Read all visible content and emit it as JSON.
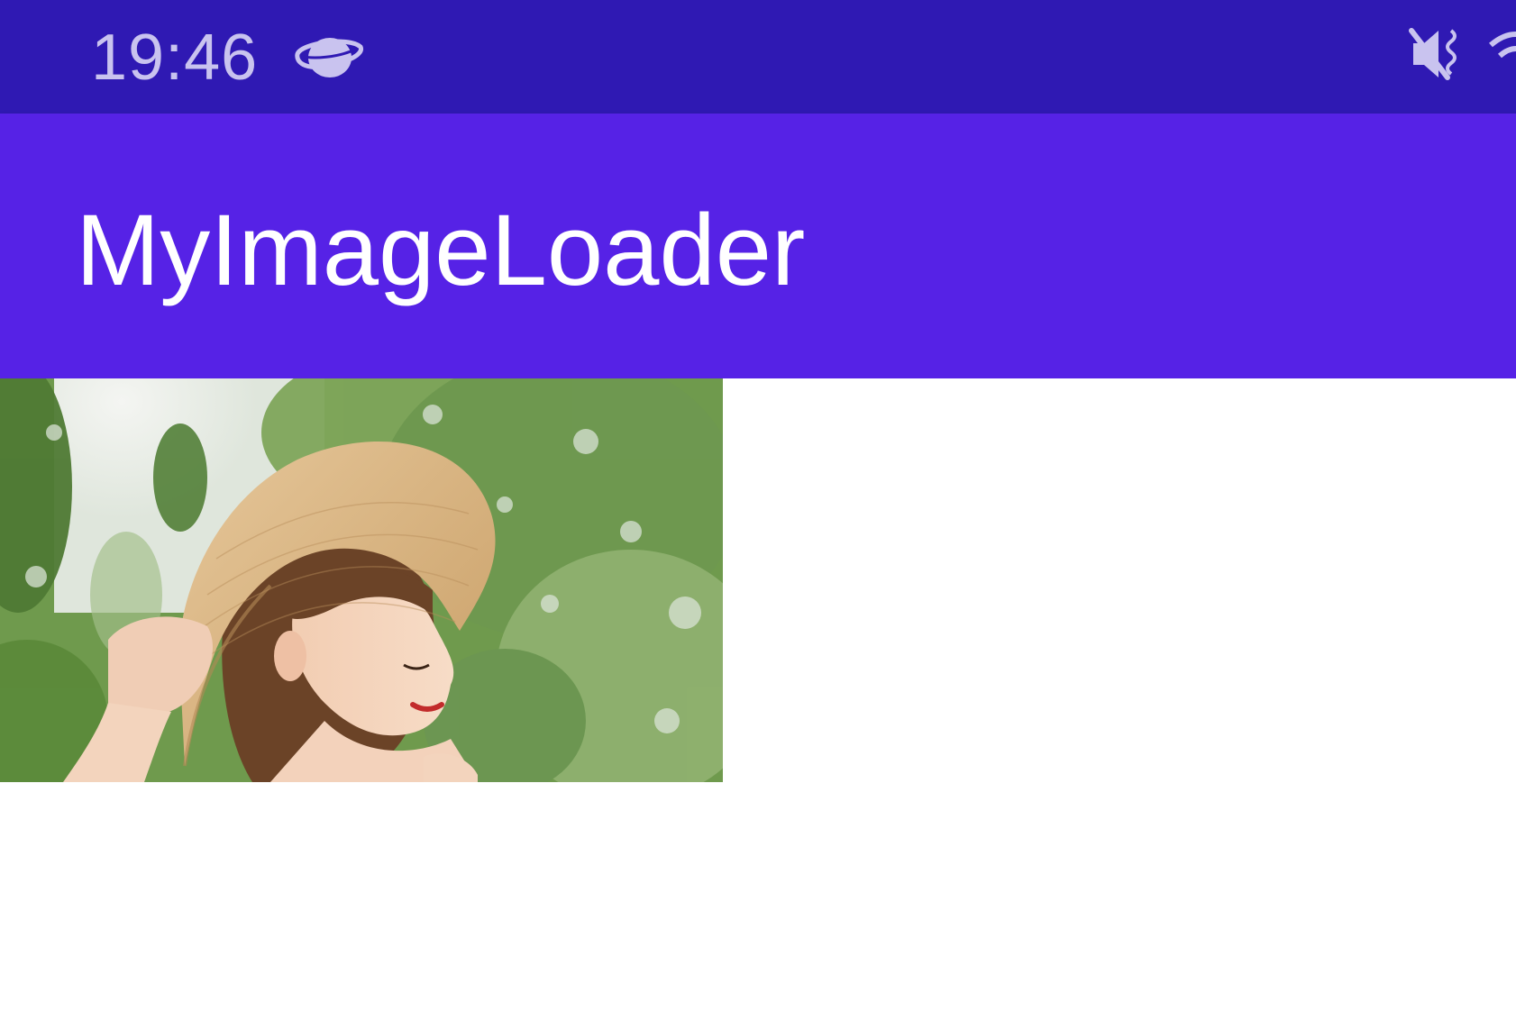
{
  "status_bar": {
    "time": "19:46",
    "icons": [
      "planet-icon",
      "mute-icon",
      "wifi-icon"
    ],
    "background": "#2f19b3"
  },
  "app_bar": {
    "title": "MyImageLoader",
    "background": "#5622e6"
  },
  "content": {
    "image": {
      "description_icon": "photo-image"
    }
  }
}
